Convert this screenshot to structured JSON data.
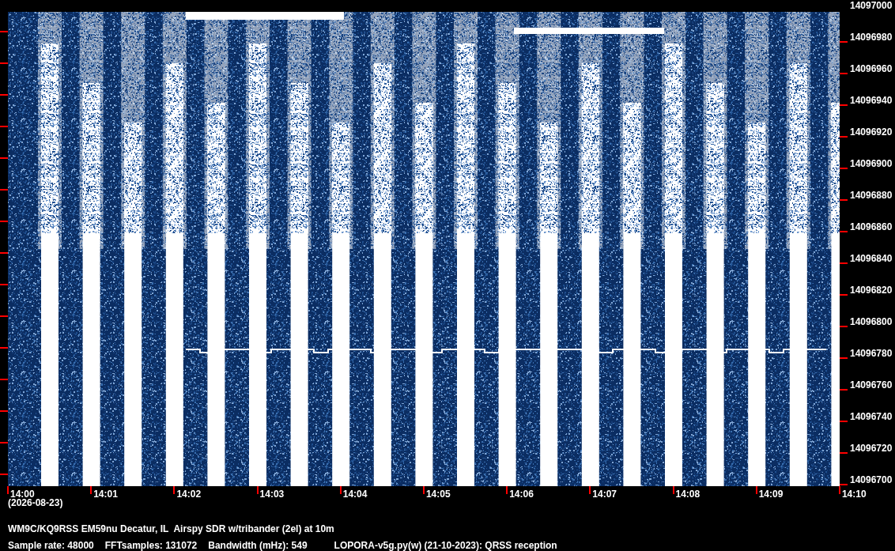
{
  "frequency_axis": {
    "labels": [
      "14097000",
      "14096980",
      "14096960",
      "14096940",
      "14096920",
      "14096900",
      "14096880",
      "14096860",
      "14096840",
      "14096820",
      "14096800",
      "14096780",
      "14096760",
      "14096740",
      "14096720",
      "14096700"
    ]
  },
  "time_axis": {
    "labels": [
      "14:00",
      "14:01",
      "14:02",
      "14:03",
      "14:04",
      "14:05",
      "14:06",
      "14:07",
      "14:08",
      "14:09",
      "14:10"
    ],
    "date": "(2026-08-23)"
  },
  "footer": {
    "station": "WM9C/KQ9RSS EM59nu Decatur, IL  Airspy SDR w/tribander (2el) at 10m",
    "parameters": [
      "Sample rate: 48000",
      "FFTsamples: 131072",
      "Bandwidth (mHz): 549"
    ],
    "software": "LOPORA-v5g.py(w) (21-10-2023): QRSS reception"
  }
}
